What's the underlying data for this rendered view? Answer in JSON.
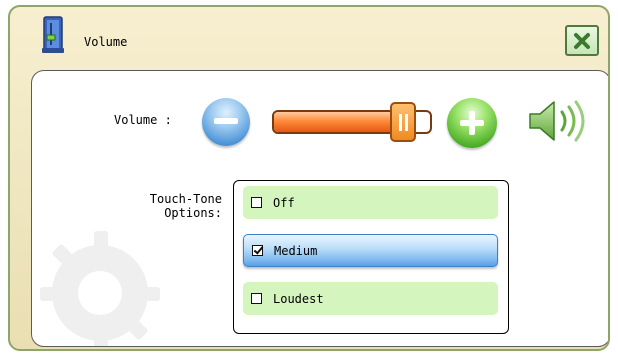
{
  "window": {
    "title": "Volume",
    "icon": "volume-app-icon",
    "close_icon": "close-x-icon"
  },
  "volume": {
    "label": "Volume :",
    "level": 0.88,
    "decrease_icon": "minus-icon",
    "increase_icon": "plus-icon",
    "speaker_icon": "speaker-icon"
  },
  "touch_tone": {
    "label_line1": "Touch-Tone",
    "label_line2": "Options:",
    "options": [
      {
        "label": "Off",
        "checked": false
      },
      {
        "label": "Medium",
        "checked": true
      },
      {
        "label": "Loudest",
        "checked": false
      }
    ]
  },
  "colors": {
    "accent_green": "#6cc33a",
    "frame_border": "#8da46a",
    "selected_blue": "#7ebaf0",
    "slider_orange": "#f07a2a"
  }
}
